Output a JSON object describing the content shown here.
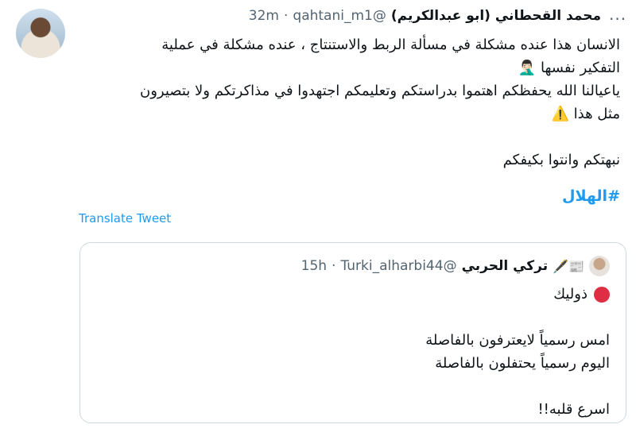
{
  "tweet": {
    "author_name": "محمد القحطاني (ابو عبدالكريم)",
    "handle": "@qahtani_m1",
    "separator": "·",
    "time": "32m",
    "lines": [
      "الانسان هذا عنده مشكلة في مسألة الربط والاستنتاج ، عنده مشكلة في عملية",
      "التفكير نفسها",
      "ياعيالنا الله يحفظكم اهتموا بدراستكم وتعليمكم اجتهدوا في مذاكرتكم ولا بتصيرون",
      "مثل هذا",
      "نبهتكم وانتوا بكيفكم"
    ],
    "emoji_facepalm": "🤦🏻‍♂️",
    "emoji_warning": "⚠️",
    "hashtag": "#الهلال",
    "translate_label": "Translate Tweet",
    "more_icon": "more-horizontal-icon"
  },
  "quote": {
    "author_name": "تركي الحربي",
    "handle": "@Turki_alharbi44",
    "separator": "·",
    "time": "15h",
    "name_icons": "📰🖋️",
    "lines": [
      "ذوليك",
      "امس رسمياً لايعترفون بالفاصلة",
      "اليوم رسمياً يحتفلون بالفاصلة",
      "اسرع قلبه!!"
    ],
    "dot_color": "#dd2e44"
  }
}
